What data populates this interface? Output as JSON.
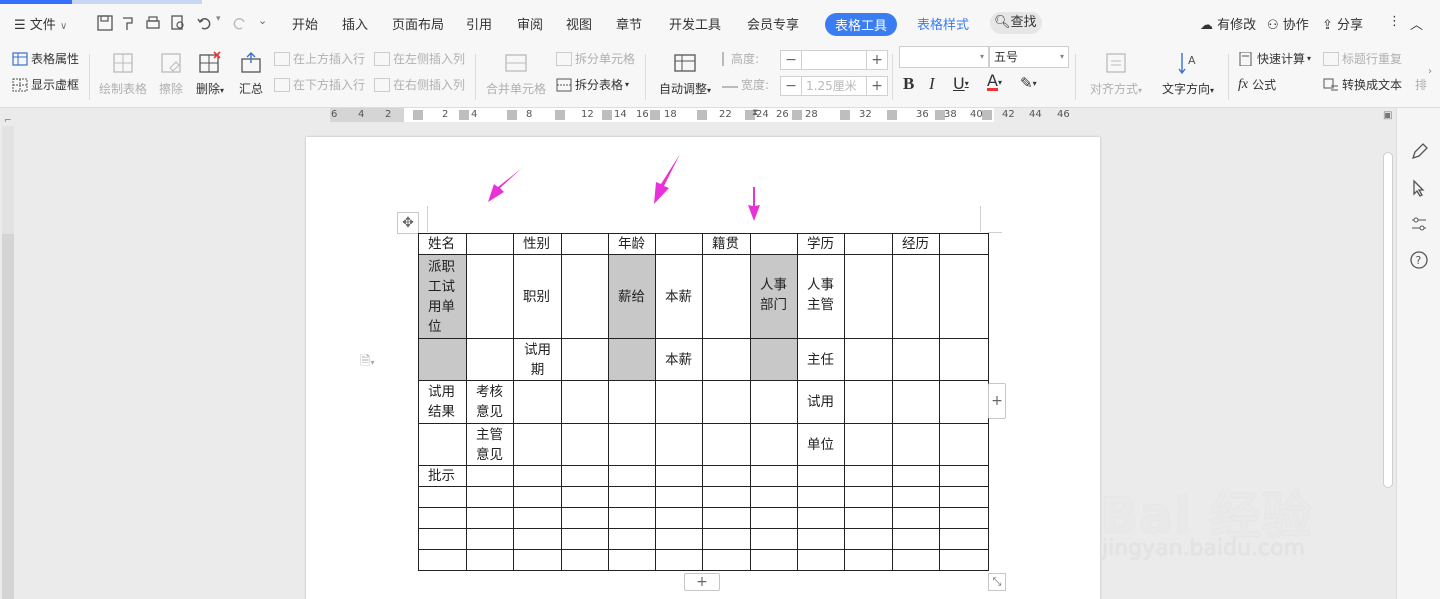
{
  "menubar": {
    "file_label": "文件",
    "tabs": [
      {
        "label": "开始"
      },
      {
        "label": "插入"
      },
      {
        "label": "页面布局"
      },
      {
        "label": "引用"
      },
      {
        "label": "审阅"
      },
      {
        "label": "视图"
      },
      {
        "label": "章节"
      },
      {
        "label": "开发工具"
      },
      {
        "label": "会员专享"
      },
      {
        "label": "表格工具"
      },
      {
        "label": "表格样式"
      }
    ],
    "search_label": "查找",
    "right": {
      "modified": "有修改",
      "collab": "协作",
      "share": "分享"
    }
  },
  "ribbon": {
    "table_props": "表格属性",
    "show_gridlines": "显示虚框",
    "draw_table": "绘制表格",
    "erase": "擦除",
    "delete": "删除",
    "summary": "汇总",
    "insert_above": "在上方插入行",
    "insert_below": "在下方插入行",
    "insert_left": "在左侧插入列",
    "insert_right": "在右侧插入列",
    "merge_cells": "合并单元格",
    "split_cells": "拆分单元格",
    "split_table": "拆分表格",
    "autofit": "自动调整",
    "height_label": "高度:",
    "width_label": "宽度:",
    "width_value": "1.25厘米",
    "font_size": "五号",
    "align": "对齐方式",
    "text_direction": "文字方向",
    "quick_calc": "快速计算",
    "formula": "公式",
    "repeat_header": "标题行重复",
    "to_text": "转换成文本",
    "overflow": "排"
  },
  "ruler": {
    "ticks": [
      "6",
      "4",
      "2",
      "2",
      "4",
      "8",
      "12",
      "14",
      "16",
      "18",
      "22",
      "24",
      "26",
      "28",
      "32",
      "36",
      "38",
      "40",
      "42",
      "44",
      "46"
    ]
  },
  "table": {
    "rows": [
      [
        "姓名",
        "",
        "性别",
        "",
        "年龄",
        "",
        "籍贯",
        "",
        "学历",
        "",
        "经历",
        ""
      ],
      [
        "派职工试用单位",
        "",
        "职别",
        "",
        "薪给",
        "本薪",
        "",
        "人事部门",
        "人事主管",
        "",
        "",
        ""
      ],
      [
        "",
        "",
        "试用期",
        "",
        "",
        "本薪",
        "",
        "",
        "主任",
        "",
        "",
        ""
      ],
      [
        "试用结果",
        "考核意见",
        "",
        "",
        "",
        "",
        "",
        "",
        "试用",
        "",
        "",
        ""
      ],
      [
        "",
        "主管意见",
        "",
        "",
        "",
        "",
        "",
        "",
        "单位",
        "",
        "",
        ""
      ],
      [
        "批示",
        "",
        "",
        "",
        "",
        "",
        "",
        "",
        "",
        "",
        "",
        ""
      ],
      [
        "",
        "",
        "",
        "",
        "",
        "",
        "",
        "",
        "",
        "",
        "",
        ""
      ],
      [
        "",
        "",
        "",
        "",
        "",
        "",
        "",
        "",
        "",
        "",
        "",
        ""
      ],
      [
        "",
        "",
        "",
        "",
        "",
        "",
        "",
        "",
        "",
        "",
        "",
        ""
      ],
      [
        "",
        "",
        "",
        "",
        "",
        "",
        "",
        "",
        "",
        "",
        "",
        ""
      ]
    ]
  },
  "watermark": {
    "text": "Bai 经验",
    "sub": "jingyan.baidu.com"
  },
  "colors": {
    "accent": "#3a7cf2",
    "arrow": "#e832d8",
    "gray_cell": "#c8c8c8"
  }
}
